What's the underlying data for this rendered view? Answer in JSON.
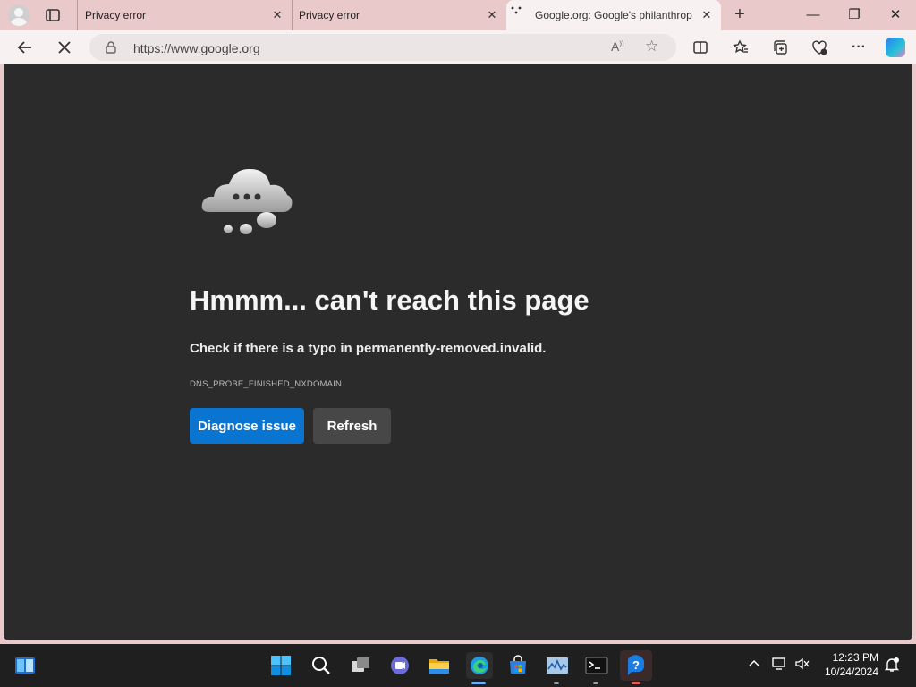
{
  "browser": {
    "tabs": [
      {
        "label": "Privacy error",
        "state": "inactive"
      },
      {
        "label": "Privacy error",
        "state": "inactive"
      },
      {
        "label": "Google.org: Google's philanthrop",
        "state": "active"
      }
    ],
    "address_url": "https://www.google.org",
    "colors": {
      "frame": "#e9c9c9",
      "toolbar": "#f7f1f1"
    }
  },
  "error_page": {
    "heading": "Hmmm... can't reach this page",
    "message": "Check if there is a typo in permanently-removed.invalid.",
    "error_code": "DNS_PROBE_FINISHED_NXDOMAIN",
    "buttons": {
      "diagnose": "Diagnose issue",
      "refresh": "Refresh"
    },
    "colors": {
      "background": "#2b2b2b",
      "primary_button": "#0a74d1",
      "secondary_button": "#474747"
    }
  },
  "taskbar": {
    "apps": [
      "start-icon",
      "search-icon",
      "task-view-icon",
      "teams-icon",
      "file-explorer-icon",
      "edge-icon",
      "store-icon",
      "task-manager-icon",
      "terminal-icon",
      "help-icon"
    ],
    "clock": {
      "time": "12:23 PM",
      "date": "10/24/2024"
    }
  }
}
